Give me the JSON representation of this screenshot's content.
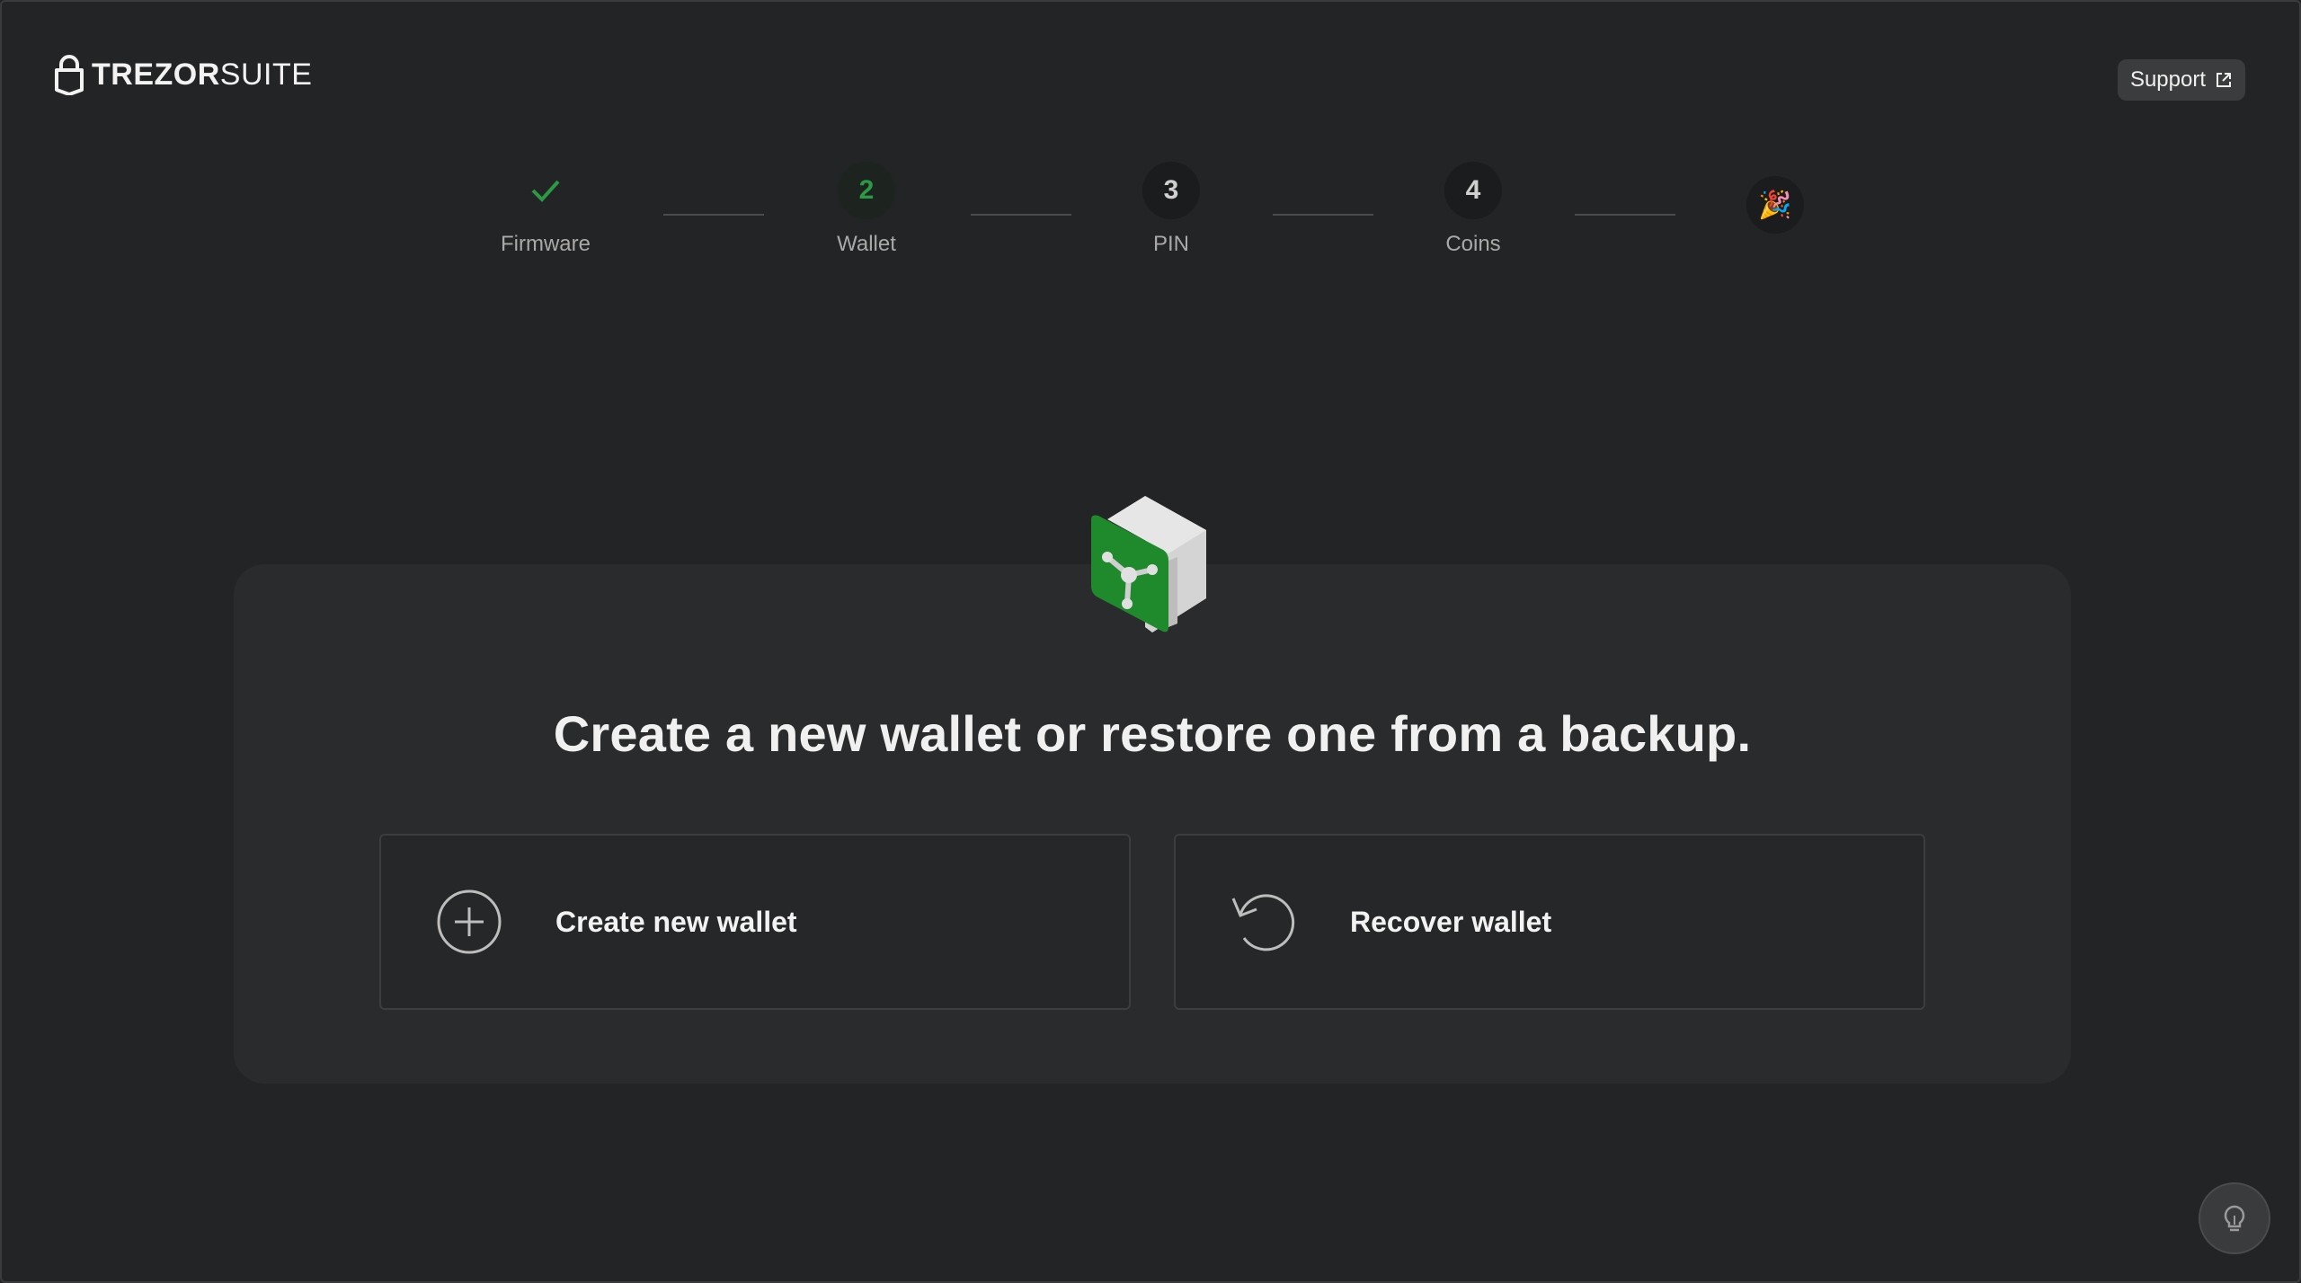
{
  "app": {
    "logo_bold": "TREZOR",
    "logo_light": "SUITE",
    "support_label": "Support"
  },
  "stepper": {
    "steps": [
      {
        "label": "Firmware",
        "number": "",
        "state": "done"
      },
      {
        "label": "Wallet",
        "number": "2",
        "state": "active"
      },
      {
        "label": "PIN",
        "number": "3",
        "state": "pending"
      },
      {
        "label": "Coins",
        "number": "4",
        "state": "pending"
      },
      {
        "label": "",
        "number": "",
        "state": "final",
        "icon": "party-popper-icon"
      }
    ]
  },
  "main": {
    "headline": "Create a new wallet or restore one from a backup.",
    "options": [
      {
        "label": "Create new wallet",
        "icon": "plus-circle-icon"
      },
      {
        "label": "Recover wallet",
        "icon": "recover-arrow-icon"
      }
    ]
  },
  "colors": {
    "background": "#232425",
    "card": "#2a2b2c",
    "accent_green": "#2b9a45"
  }
}
